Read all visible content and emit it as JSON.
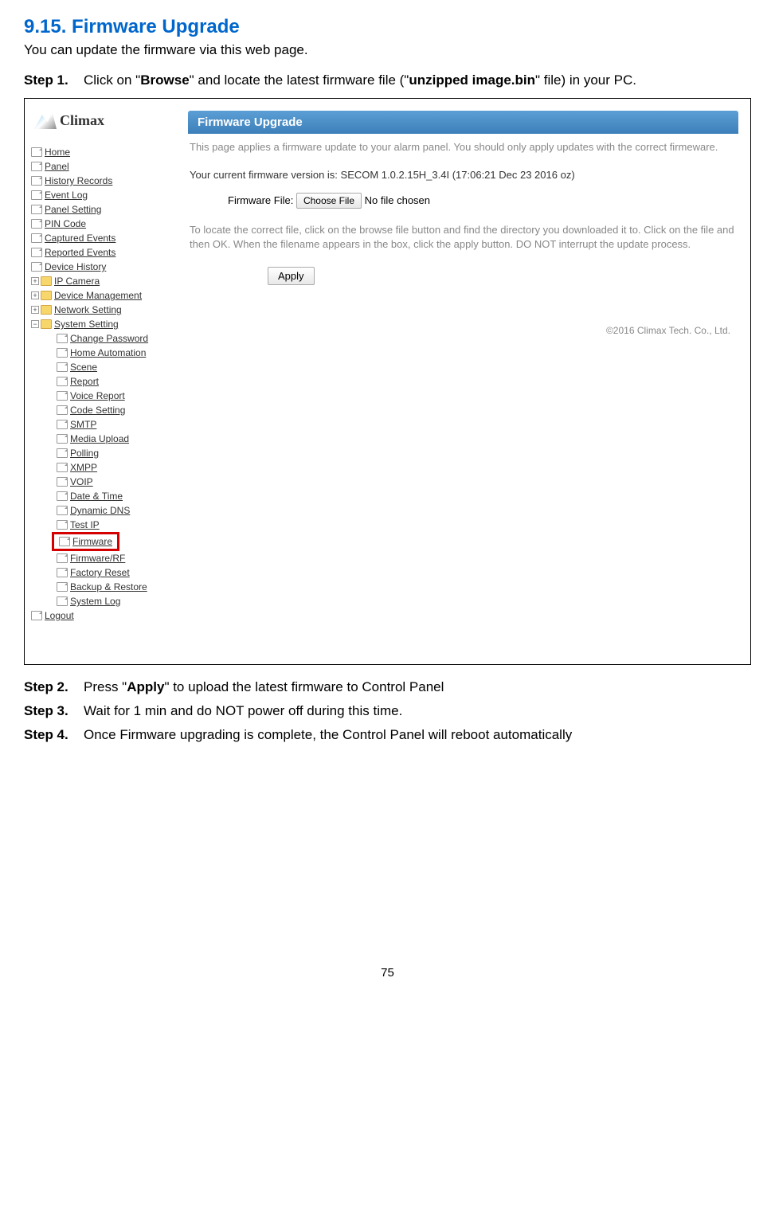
{
  "doc": {
    "sectionTitle": "9.15. Firmware Upgrade",
    "sectionDesc": "You can update the firmware via this web page.",
    "step1Label": "Step 1.",
    "step1Pre": "Click on \"",
    "step1Bold1": "Browse",
    "step1Mid": "\" and locate the latest firmware file (\"",
    "step1Bold2": "unzipped image.bin",
    "step1Post": "\" file) in your PC.",
    "step2Label": "Step 2.",
    "step2Pre": "Press \"",
    "step2Bold": "Apply",
    "step2Post": "\" to upload the latest firmware to Control Panel",
    "step3Label": "Step 3.",
    "step3Text": "Wait for 1 min and do NOT power off during this time.",
    "step4Label": "Step 4.",
    "step4Text": "Once Firmware upgrading is complete, the Control Panel will reboot automatically",
    "pageNumber": "75"
  },
  "ui": {
    "logoText": "Climax",
    "nav": {
      "home": "Home",
      "panel": "Panel",
      "history": "History Records",
      "eventlog": "Event Log",
      "panelsetting": "Panel Setting",
      "pincode": "PIN Code",
      "captured": "Captured Events",
      "reported": "Reported Events",
      "devicehistory": "Device History",
      "ipcamera": "IP Camera",
      "devmgmt": "Device Management",
      "netsetting": "Network Setting",
      "syssetting": "System Setting",
      "changepw": "Change Password",
      "homeauto": "Home Automation",
      "scene": "Scene",
      "report": "Report",
      "voicereport": "Voice Report",
      "codesetting": "Code Setting",
      "smtp": "SMTP",
      "mediaupload": "Media Upload",
      "polling": "Polling",
      "xmpp": "XMPP",
      "voip": "VOIP",
      "datetime": "Date & Time",
      "dyndns": "Dynamic DNS",
      "testip": "Test IP",
      "firmware": "Firmware",
      "firmwarerf": "Firmware/RF",
      "factoryreset": "Factory Reset",
      "backup": "Backup & Restore",
      "systemlog": "System Log",
      "logout": "Logout"
    },
    "content": {
      "header": "Firmware Upgrade",
      "desc": "This page applies a firmware update to your alarm panel. You should only apply updates with the correct firmeware.",
      "version": "Your current firmware version is: SECOM 1.0.2.15H_3.4I (17:06:21 Dec 23 2016 oz)",
      "fileLabel": "Firmware File:",
      "chooseBtn": "Choose File",
      "noFile": "No file chosen",
      "instructions": "To locate the correct file, click on the browse file button and find the directory you downloaded it to. Click on the file and then OK. When the filename appears in the box, click the apply button. DO NOT interrupt the update process.",
      "applyBtn": "Apply",
      "footer": "©2016 Climax Tech. Co., Ltd."
    }
  }
}
